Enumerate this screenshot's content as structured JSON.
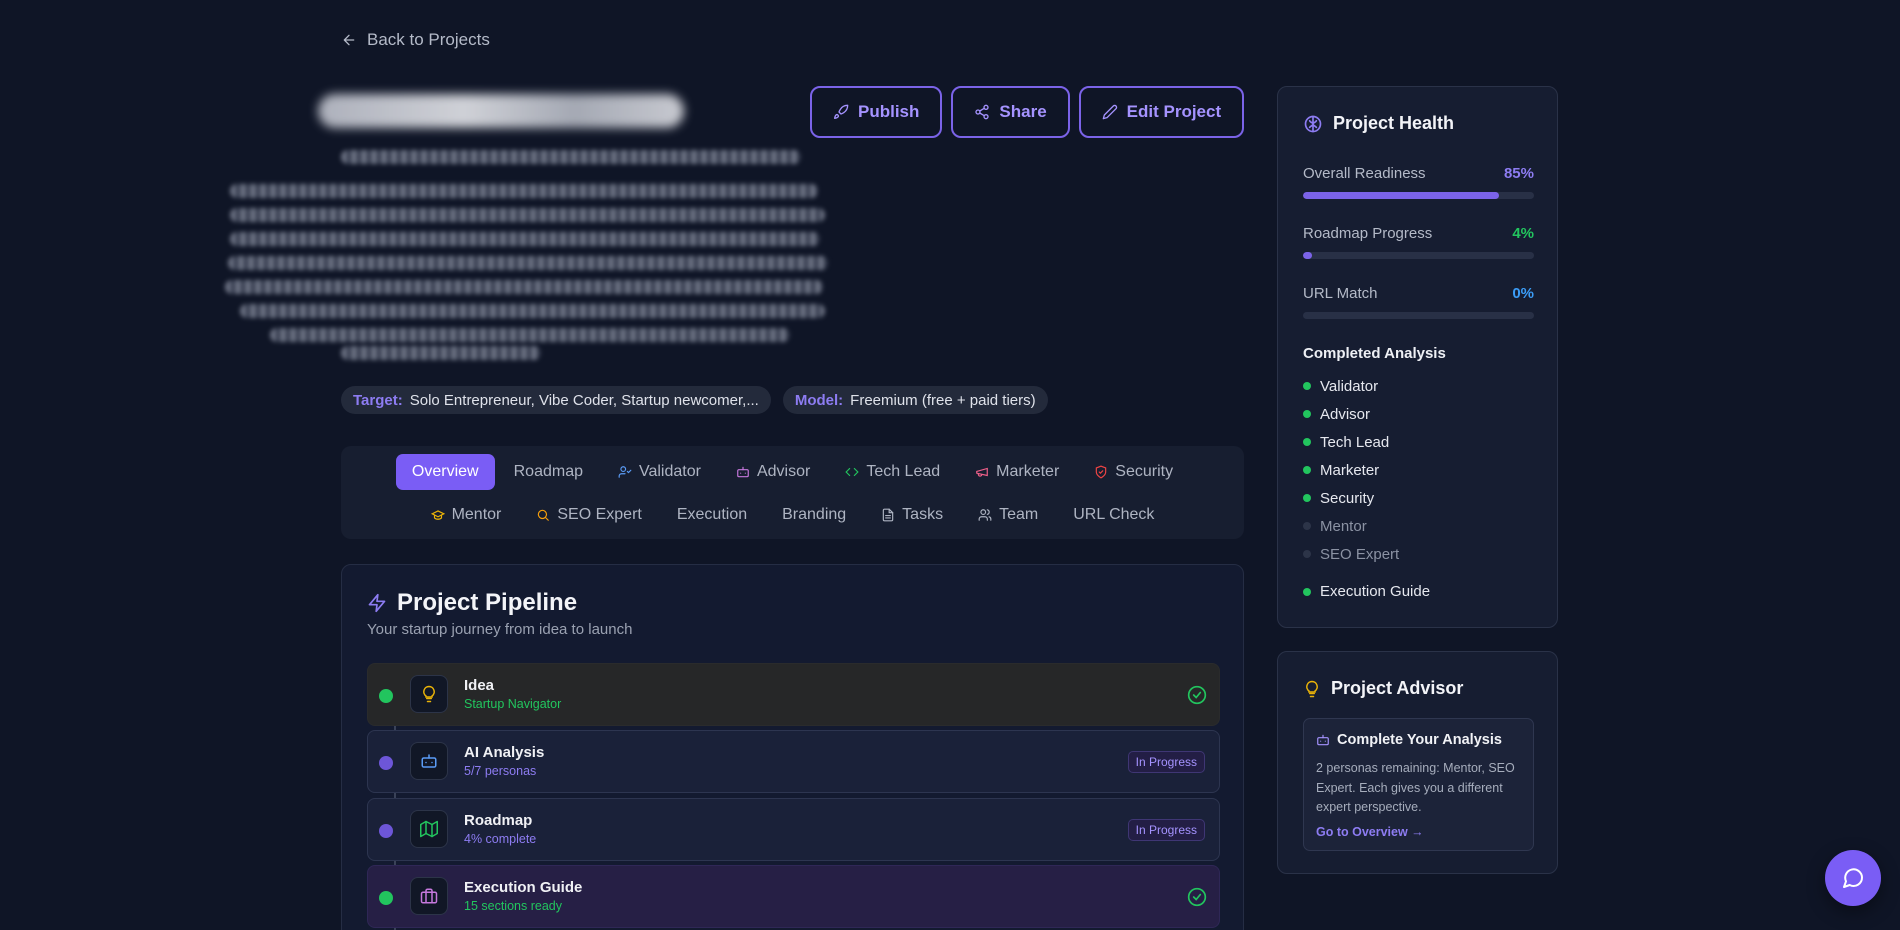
{
  "nav": {
    "back_label": "Back to Projects"
  },
  "actions": {
    "publish": "Publish",
    "share": "Share",
    "edit": "Edit Project"
  },
  "pills": [
    {
      "key": "Target:",
      "value": "Solo Entrepreneur, Vibe Coder, Startup newcomer,..."
    },
    {
      "key": "Model:",
      "value": "Freemium (free + paid tiers)"
    }
  ],
  "tabs": {
    "row1": [
      "Overview",
      "Roadmap",
      "Validator",
      "Advisor",
      "Tech Lead",
      "Marketer",
      "Security"
    ],
    "row2": [
      "Mentor",
      "SEO Expert",
      "Execution",
      "Branding",
      "Tasks",
      "Team",
      "URL Check"
    ],
    "active": "Overview"
  },
  "pipeline": {
    "title": "Project Pipeline",
    "subtitle": "Your startup journey from idea to launch",
    "stages": [
      {
        "name": "Idea",
        "meta": "Startup Navigator",
        "status": "done"
      },
      {
        "name": "AI Analysis",
        "meta": "5/7 personas",
        "status": "In Progress"
      },
      {
        "name": "Roadmap",
        "meta": "4% complete",
        "status": "In Progress"
      },
      {
        "name": "Execution Guide",
        "meta": "15 sections ready",
        "status": "done"
      }
    ]
  },
  "health": {
    "title": "Project Health",
    "metrics": [
      {
        "label": "Overall Readiness",
        "value": "85%",
        "fraction": 0.85,
        "color": "#8d7cf2"
      },
      {
        "label": "Roadmap Progress",
        "value": "4%",
        "fraction": 0.04,
        "color": "#22c55e"
      },
      {
        "label": "URL Match",
        "value": "0%",
        "fraction": 0,
        "color": "#3b9cf6"
      }
    ],
    "analysis_title": "Completed Analysis",
    "analysis": [
      {
        "label": "Validator",
        "done": true
      },
      {
        "label": "Advisor",
        "done": true
      },
      {
        "label": "Tech Lead",
        "done": true
      },
      {
        "label": "Marketer",
        "done": true
      },
      {
        "label": "Security",
        "done": true
      },
      {
        "label": "Mentor",
        "done": false
      },
      {
        "label": "SEO Expert",
        "done": false
      }
    ],
    "execution_guide": "Execution Guide"
  },
  "advisor": {
    "title": "Project Advisor",
    "box_title": "Complete Your Analysis",
    "box_text": "2 personas remaining: Mentor, SEO Expert. Each gives you a different expert perspective.",
    "link": "Go to Overview →"
  },
  "colors": {
    "accent": "#7a5df5",
    "success": "#22c55e",
    "background": "#0f1526"
  }
}
